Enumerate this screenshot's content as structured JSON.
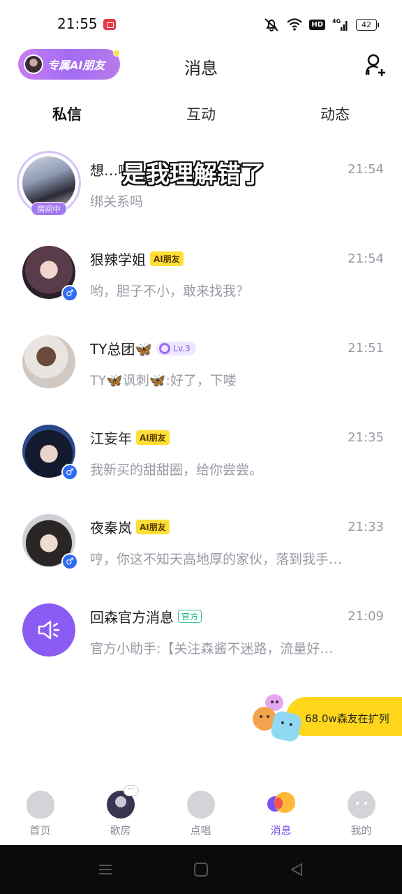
{
  "status_bar": {
    "time": "21:55",
    "battery": "42",
    "hd": "HD",
    "network": "4G"
  },
  "header": {
    "ai_friend_label": "专属AI朋友",
    "title": "消息"
  },
  "tabs": [
    {
      "label": "私信",
      "active": true
    },
    {
      "label": "互动",
      "active": false
    },
    {
      "label": "动态",
      "active": false
    }
  ],
  "chats": [
    {
      "name": "想…嗯",
      "time": "21:54",
      "preview": "绑关系吗",
      "room_badge": "房间中",
      "subtitle_overlay": "是我理解错了"
    },
    {
      "name": "狠辣学姐",
      "tag": "AI朋友",
      "time": "21:54",
      "preview": "哟，胆子不小，敢来找我？",
      "gender": "♂"
    },
    {
      "name": "TY总团🦋",
      "level": "Lv.3",
      "time": "21:51",
      "preview": "TY🦋讽刺🦋:好了，下喽"
    },
    {
      "name": "江妄年",
      "tag": "AI朋友",
      "time": "21:35",
      "preview": "我新买的甜甜圈，给你尝尝。",
      "gender": "♂"
    },
    {
      "name": "夜秦岚",
      "tag": "AI朋友",
      "time": "21:33",
      "preview": "哼，你这不知天高地厚的家伙，落到我手…",
      "gender": "♂"
    },
    {
      "name": "回森官方消息",
      "official_tag": "官方",
      "time": "21:09",
      "preview": "官方小助手:【关注森酱不迷路，流量好…"
    }
  ],
  "promo": {
    "text": "68.0w森友在扩列"
  },
  "bottom_nav": [
    {
      "label": "首页",
      "icon": "home-icon"
    },
    {
      "label": "歌房",
      "icon": "song-room-avatar",
      "more": "···"
    },
    {
      "label": "点唱",
      "icon": "sing-icon"
    },
    {
      "label": "消息",
      "icon": "message-icon",
      "active": true
    },
    {
      "label": "我的",
      "icon": "profile-icon"
    }
  ],
  "colors": {
    "accent": "#7a4ff0",
    "tag_yellow": "#ffde36",
    "promo_yellow": "#ffd61c",
    "gender_blue": "#2f6cf3",
    "official_green": "#15b37d"
  }
}
